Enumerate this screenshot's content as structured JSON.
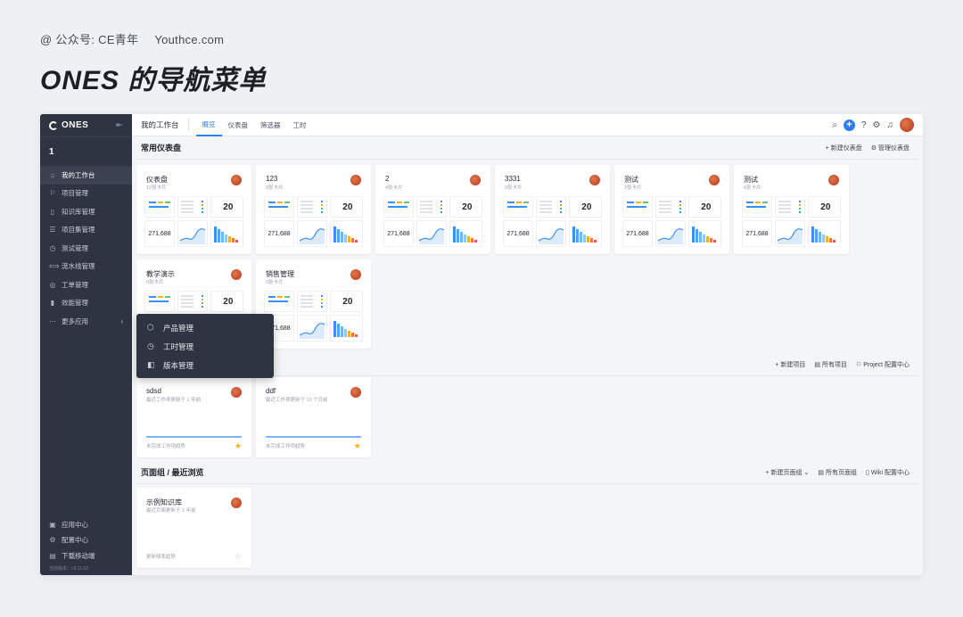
{
  "header": {
    "credit_account": "@ 公众号: CE青年",
    "credit_site": "Youthce.com",
    "title": "ONES 的导航菜单"
  },
  "sidebar": {
    "logo": "ONES",
    "team": "1",
    "items": [
      {
        "label": "我的工作台",
        "icon": "home-icon",
        "glyph": "⌂"
      },
      {
        "label": "项目管理",
        "icon": "project-icon",
        "glyph": "⚐"
      },
      {
        "label": "知识库管理",
        "icon": "wiki-icon",
        "glyph": "▯"
      },
      {
        "label": "项目集管理",
        "icon": "program-icon",
        "glyph": "☰"
      },
      {
        "label": "测试管理",
        "icon": "test-icon",
        "glyph": "◷"
      },
      {
        "label": "流水线管理",
        "icon": "pipeline-icon",
        "glyph": "⟺"
      },
      {
        "label": "工单管理",
        "icon": "ticket-icon",
        "glyph": "◎"
      },
      {
        "label": "效能管理",
        "icon": "performance-icon",
        "glyph": "▮"
      },
      {
        "label": "更多应用",
        "icon": "more-icon",
        "glyph": "⋯"
      }
    ],
    "bottom_items": [
      {
        "label": "应用中心",
        "icon": "app-center-icon",
        "glyph": "▣"
      },
      {
        "label": "配置中心",
        "icon": "settings-icon",
        "glyph": "⚙"
      },
      {
        "label": "下载移动端",
        "icon": "download-icon",
        "glyph": "▤"
      }
    ],
    "version": "当前版本：v3.11.53"
  },
  "topbar": {
    "workspace": "我的工作台",
    "tabs": [
      "概览",
      "仪表盘",
      "筛选器",
      "工时"
    ],
    "active_tab": 0
  },
  "popup": {
    "items": [
      {
        "label": "产品管理",
        "icon": "cube-icon",
        "glyph": "⬡"
      },
      {
        "label": "工时管理",
        "icon": "clock-icon",
        "glyph": "◷"
      },
      {
        "label": "版本管理",
        "icon": "version-icon",
        "glyph": "◧"
      }
    ]
  },
  "dashboards": {
    "title": "常用仪表盘",
    "actions": [
      "新建仪表盘",
      "管理仪表盘"
    ],
    "cards": [
      {
        "title": "仪表盘",
        "subtitle": "12张卡片"
      },
      {
        "title": "123",
        "subtitle": "0张卡片"
      },
      {
        "title": "2",
        "subtitle": "4张卡片"
      },
      {
        "title": "3331",
        "subtitle": "0张卡片"
      },
      {
        "title": "测试",
        "subtitle": "2张卡片"
      },
      {
        "title": "测试",
        "subtitle": "6张卡片"
      },
      {
        "title": "教学演示",
        "subtitle": "0张卡片"
      },
      {
        "title": "销售管理",
        "subtitle": "0张卡片"
      }
    ],
    "preview_number": "20",
    "preview_total": "271,688"
  },
  "projects": {
    "actions": [
      "新建项目",
      "所有项目",
      "Project 配置中心"
    ],
    "cards": [
      {
        "title": "sdsd",
        "subtitle": "最近工作项更新于 1 年前",
        "footer": "未完成工作项趋势",
        "starred": true
      },
      {
        "title": "ddf",
        "subtitle": "最近工作项更新于 10 个月前",
        "footer": "未完成工作项趋势",
        "starred": true
      }
    ]
  },
  "pages": {
    "title": "页面组 / 最近浏览",
    "actions": [
      "新建页面组",
      "所有页面组",
      "Wiki 配置中心"
    ],
    "cards": [
      {
        "title": "示例知识库",
        "subtitle": "最近页面更新于 2 年前",
        "footer": "更新频率趋势",
        "starred": false
      }
    ]
  },
  "colors": {
    "sidebar_bg": "#2f3442",
    "accent": "#2e7cf6",
    "star": "#f2b21e"
  }
}
